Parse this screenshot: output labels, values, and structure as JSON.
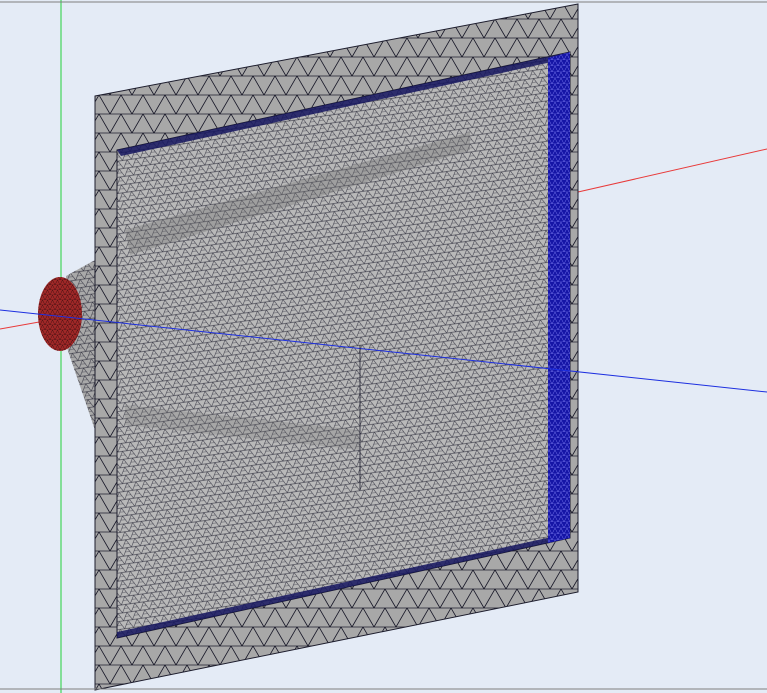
{
  "viewport": {
    "background_color": "#e4ebf6",
    "frame_color": "#7f7f7f"
  },
  "axes": {
    "x_axis_color": "#e83a3a",
    "y_axis_color": "#22d13a",
    "z_axis_color": "#1d2fe0"
  },
  "mesh": {
    "face_color": "#a8a8a8",
    "inner_face_color": "#b9b9b9",
    "edge_color": "#1c1c2c",
    "boundary_selected_color": "#1515a6",
    "port_selected_color": "#a12828"
  },
  "labels": {
    "label_1": "",
    "label_2": "",
    "label_3": ""
  }
}
